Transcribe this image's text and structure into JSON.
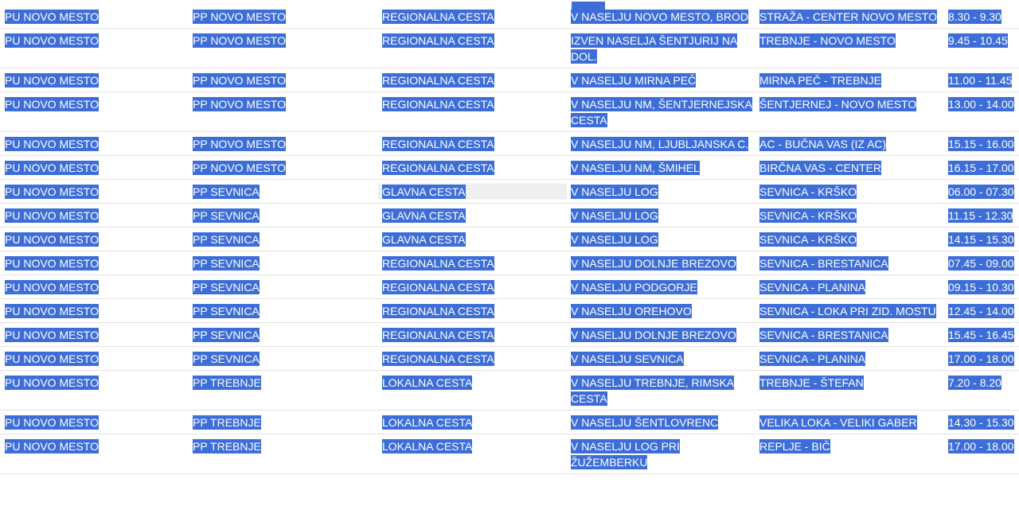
{
  "colors": {
    "highlight": "#3d6ed8",
    "highlight_text": "#ffffff",
    "row_border": "#e2e2e2",
    "unselected_cell": "#efefef"
  },
  "rows": [
    [
      "PU NOVO MESTO",
      "PP NOVO MESTO",
      "REGIONALNA CESTA",
      "V NASELJU NOVO MESTO, BROD",
      "STRAŽA - CENTER NOVO MESTO",
      "8.30 - 9.30"
    ],
    [
      "PU NOVO MESTO",
      "PP NOVO MESTO",
      "REGIONALNA CESTA",
      "IZVEN NASELJA ŠENTJURIJ NA DOL.",
      "TREBNJE - NOVO MESTO",
      "9.45 - 10.45"
    ],
    [
      "PU NOVO MESTO",
      "PP NOVO MESTO",
      "REGIONALNA CESTA",
      "V NASELJU MIRNA PEČ",
      "MIRNA PEČ - TREBNJE",
      "11.00 - 11.45"
    ],
    [
      "PU NOVO MESTO",
      "PP NOVO MESTO",
      "REGIONALNA CESTA",
      "V NASELJU NM, ŠENTJERNEJSKA CESTA",
      "ŠENTJERNEJ - NOVO MESTO",
      "13.00 - 14.00"
    ],
    [
      "PU NOVO MESTO",
      "PP NOVO MESTO",
      "REGIONALNA CESTA",
      "V NASELJU NM, LJUBLJANSKA C.",
      "AC - BUČNA VAS (IZ AC)",
      "15.15 - 16.00"
    ],
    [
      "PU NOVO MESTO",
      "PP NOVO MESTO",
      "REGIONALNA CESTA",
      "V NASELJU NM, ŠMIHEL",
      "BIRČNA VAS - CENTER",
      "16.15 - 17.00"
    ],
    [
      "PU NOVO MESTO",
      "PP SEVNICA",
      "GLAVNA CESTA",
      "V NASELJU LOG",
      "SEVNICA - KRŠKO",
      "06.00 - 07.30"
    ],
    [
      "PU NOVO MESTO",
      "PP SEVNICA",
      "GLAVNA CESTA",
      "V NASELJU LOG",
      "SEVNICA - KRŠKO",
      "11.15 - 12.30"
    ],
    [
      "PU NOVO MESTO",
      "PP SEVNICA",
      "GLAVNA CESTA",
      "V NASELJU LOG",
      "SEVNICA - KRŠKO",
      "14.15 - 15.30"
    ],
    [
      "PU NOVO MESTO",
      "PP SEVNICA",
      "REGIONALNA CESTA",
      "V NASELJU DOLNJE BREZOVO",
      "SEVNICA - BRESTANICA",
      "07.45 - 09.00"
    ],
    [
      "PU NOVO MESTO",
      "PP SEVNICA",
      "REGIONALNA CESTA",
      "V NASELJU PODGORJE",
      "SEVNICA - PLANINA",
      "09.15 - 10.30"
    ],
    [
      "PU NOVO MESTO",
      "PP SEVNICA",
      "REGIONALNA CESTA",
      "V NASELJU OREHOVO",
      "SEVNICA - LOKA PRI ZID. MOSTU",
      "12.45 - 14.00"
    ],
    [
      "PU NOVO MESTO",
      "PP SEVNICA",
      "REGIONALNA CESTA",
      "V NASELJU DOLNJE BREZOVO",
      "SEVNICA - BRESTANICA",
      "15.45 - 16.45"
    ],
    [
      "PU NOVO MESTO",
      "PP SEVNICA",
      "REGIONALNA CESTA",
      "V NASELJU SEVNICA",
      "SEVNICA - PLANINA",
      "17.00 - 18.00"
    ],
    [
      "PU NOVO MESTO",
      "PP TREBNJE",
      "LOKALNA CESTA",
      "V NASELJU TREBNJE, RIMSKA CESTA",
      "TREBNJE - ŠTEFAN",
      "7.20 - 8.20"
    ],
    [
      "PU NOVO MESTO",
      "PP TREBNJE",
      "LOKALNA CESTA",
      "V NASELJU ŠENTLOVRENC",
      "VELIKA LOKA - VELIKI GABER",
      "14.30 - 15.30"
    ],
    [
      "PU NOVO MESTO",
      "PP TREBNJE",
      "LOKALNA CESTA",
      "V NASELJU LOG PRI ŽUŽEMBERKU",
      "REPLJE - BIČ",
      "17.00 - 18.00"
    ]
  ]
}
